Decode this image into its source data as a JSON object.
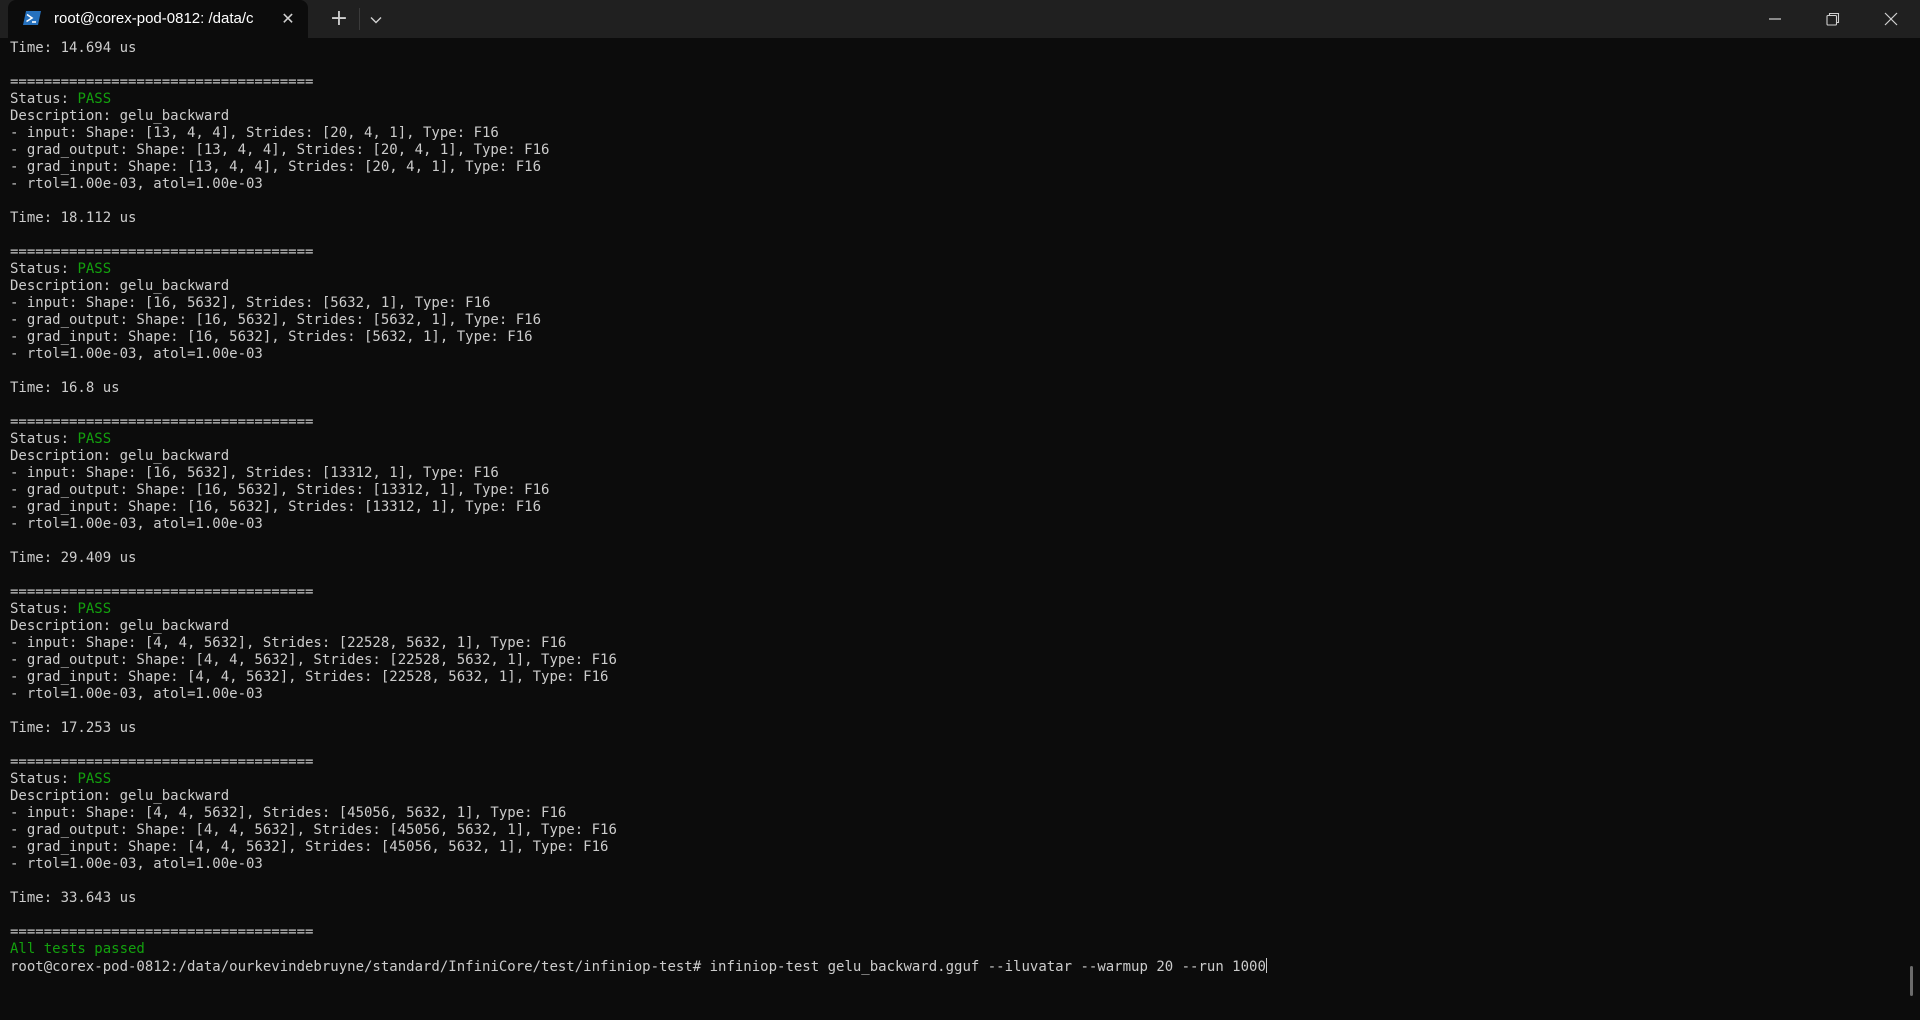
{
  "window": {
    "tab_title": "root@corex-pod-0812: /data/c",
    "new_tab_symbol": "+",
    "dropdown_symbol": "⌄",
    "close_tab_symbol": "✕"
  },
  "terminal": {
    "lines": [
      {
        "text": "Time: 14.694 us"
      },
      {
        "text": ""
      },
      {
        "text": "===================================="
      },
      {
        "prefix": "Status: ",
        "status": "PASS"
      },
      {
        "text": "Description: gelu_backward"
      },
      {
        "text": "- input: Shape: [13, 4, 4], Strides: [20, 4, 1], Type: F16"
      },
      {
        "text": "- grad_output: Shape: [13, 4, 4], Strides: [20, 4, 1], Type: F16"
      },
      {
        "text": "- grad_input: Shape: [13, 4, 4], Strides: [20, 4, 1], Type: F16"
      },
      {
        "text": "- rtol=1.00e-03, atol=1.00e-03"
      },
      {
        "text": ""
      },
      {
        "text": "Time: 18.112 us"
      },
      {
        "text": ""
      },
      {
        "text": "===================================="
      },
      {
        "prefix": "Status: ",
        "status": "PASS"
      },
      {
        "text": "Description: gelu_backward"
      },
      {
        "text": "- input: Shape: [16, 5632], Strides: [5632, 1], Type: F16"
      },
      {
        "text": "- grad_output: Shape: [16, 5632], Strides: [5632, 1], Type: F16"
      },
      {
        "text": "- grad_input: Shape: [16, 5632], Strides: [5632, 1], Type: F16"
      },
      {
        "text": "- rtol=1.00e-03, atol=1.00e-03"
      },
      {
        "text": ""
      },
      {
        "text": "Time: 16.8 us"
      },
      {
        "text": ""
      },
      {
        "text": "===================================="
      },
      {
        "prefix": "Status: ",
        "status": "PASS"
      },
      {
        "text": "Description: gelu_backward"
      },
      {
        "text": "- input: Shape: [16, 5632], Strides: [13312, 1], Type: F16"
      },
      {
        "text": "- grad_output: Shape: [16, 5632], Strides: [13312, 1], Type: F16"
      },
      {
        "text": "- grad_input: Shape: [16, 5632], Strides: [13312, 1], Type: F16"
      },
      {
        "text": "- rtol=1.00e-03, atol=1.00e-03"
      },
      {
        "text": ""
      },
      {
        "text": "Time: 29.409 us"
      },
      {
        "text": ""
      },
      {
        "text": "===================================="
      },
      {
        "prefix": "Status: ",
        "status": "PASS"
      },
      {
        "text": "Description: gelu_backward"
      },
      {
        "text": "- input: Shape: [4, 4, 5632], Strides: [22528, 5632, 1], Type: F16"
      },
      {
        "text": "- grad_output: Shape: [4, 4, 5632], Strides: [22528, 5632, 1], Type: F16"
      },
      {
        "text": "- grad_input: Shape: [4, 4, 5632], Strides: [22528, 5632, 1], Type: F16"
      },
      {
        "text": "- rtol=1.00e-03, atol=1.00e-03"
      },
      {
        "text": ""
      },
      {
        "text": "Time: 17.253 us"
      },
      {
        "text": ""
      },
      {
        "text": "===================================="
      },
      {
        "prefix": "Status: ",
        "status": "PASS"
      },
      {
        "text": "Description: gelu_backward"
      },
      {
        "text": "- input: Shape: [4, 4, 5632], Strides: [45056, 5632, 1], Type: F16"
      },
      {
        "text": "- grad_output: Shape: [4, 4, 5632], Strides: [45056, 5632, 1], Type: F16"
      },
      {
        "text": "- grad_input: Shape: [4, 4, 5632], Strides: [45056, 5632, 1], Type: F16"
      },
      {
        "text": "- rtol=1.00e-03, atol=1.00e-03"
      },
      {
        "text": ""
      },
      {
        "text": "Time: 33.643 us"
      },
      {
        "text": ""
      },
      {
        "text": "===================================="
      },
      {
        "summary": "All tests passed"
      },
      {
        "prompt": "root@corex-pod-0812:/data/ourkevindebruyne/standard/InfiniCore/test/infiniop-test# ",
        "command": "infiniop-test gelu_backward.gguf --iluvatar --warmup 20 --run 1000"
      }
    ]
  },
  "colors": {
    "background": "#0c0c0c",
    "text": "#cccccc",
    "pass": "#13a10e",
    "titlebar": "#202020"
  },
  "icons": {
    "tab": "powershell-icon",
    "window_controls": [
      "minimize-icon",
      "restore-icon",
      "close-icon"
    ]
  }
}
